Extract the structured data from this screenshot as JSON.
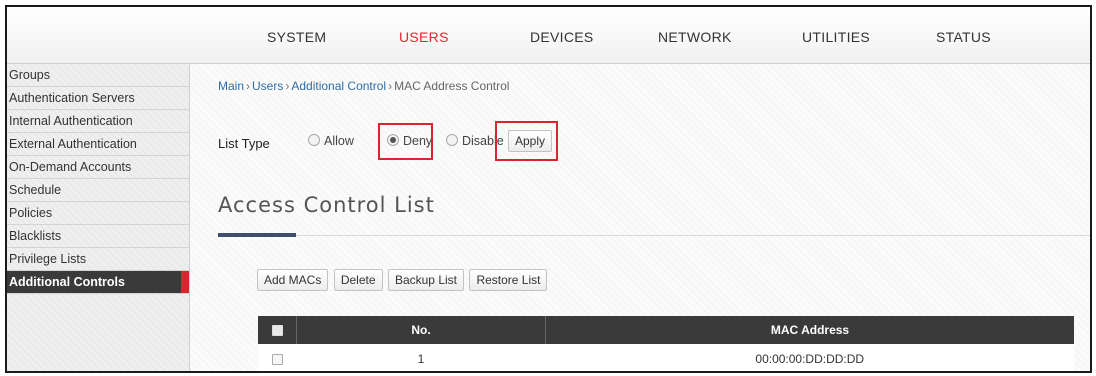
{
  "nav": {
    "tabs": [
      {
        "label": "SYSTEM"
      },
      {
        "label": "USERS"
      },
      {
        "label": "DEVICES"
      },
      {
        "label": "NETWORK"
      },
      {
        "label": "UTILITIES"
      },
      {
        "label": "STATUS"
      }
    ],
    "active_tab": "USERS",
    "active_color": "#e8262e"
  },
  "sidebar": {
    "items": [
      {
        "label": "Groups"
      },
      {
        "label": "Authentication Servers"
      },
      {
        "label": "Internal Authentication"
      },
      {
        "label": "External Authentication"
      },
      {
        "label": "On-Demand Accounts"
      },
      {
        "label": "Schedule"
      },
      {
        "label": "Policies"
      },
      {
        "label": "Blacklists"
      },
      {
        "label": "Privilege Lists"
      },
      {
        "label": "Additional Controls"
      }
    ],
    "active_item": "Additional Controls"
  },
  "breadcrumb": {
    "items": [
      "Main",
      "Users",
      "Additional Control"
    ],
    "separator": "›",
    "current": "MAC Address Control"
  },
  "list_type": {
    "label": "List Type",
    "options": [
      "Allow",
      "Deny",
      "Disable"
    ],
    "selected": "Deny",
    "apply_label": "Apply"
  },
  "section": {
    "title": "Access Control List"
  },
  "toolbar": {
    "add_label": "Add MACs",
    "delete_label": "Delete",
    "backup_label": "Backup List",
    "restore_label": "Restore List"
  },
  "table": {
    "columns": [
      "No.",
      "MAC Address"
    ],
    "rows": [
      {
        "no": "1",
        "mac": "00:00:00:DD:DD:DD"
      }
    ]
  },
  "colors": {
    "highlight": "#d9262e",
    "header_bg": "#3a3a3a",
    "accent_rule": "#3e4f6e"
  }
}
